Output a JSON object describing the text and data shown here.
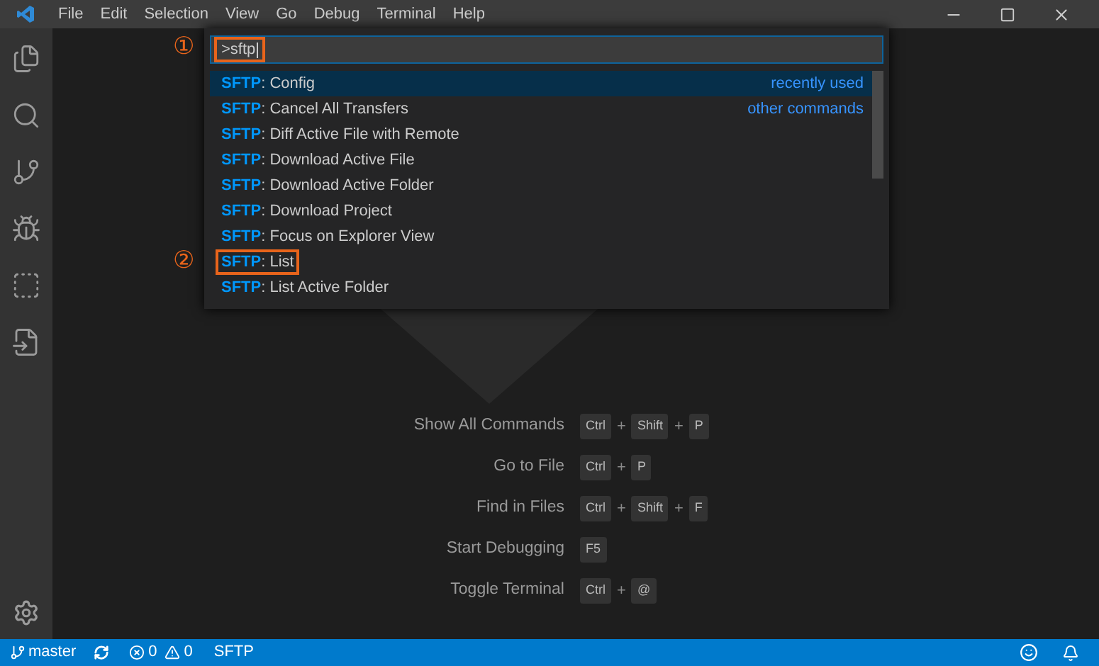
{
  "menu": [
    "File",
    "Edit",
    "Selection",
    "View",
    "Go",
    "Debug",
    "Terminal",
    "Help"
  ],
  "palette": {
    "marker": "①",
    "value": ">sftp",
    "items": [
      {
        "prefix": "SFTP",
        "label": ": Config",
        "hint": "recently used",
        "selected": true,
        "highlighted": false
      },
      {
        "prefix": "SFTP",
        "label": ": Cancel All Transfers",
        "hint": "other commands",
        "selected": false,
        "highlighted": false
      },
      {
        "prefix": "SFTP",
        "label": ": Diff Active File with Remote",
        "selected": false,
        "highlighted": false
      },
      {
        "prefix": "SFTP",
        "label": ": Download Active File",
        "selected": false,
        "highlighted": false
      },
      {
        "prefix": "SFTP",
        "label": ": Download Active Folder",
        "selected": false,
        "highlighted": false
      },
      {
        "prefix": "SFTP",
        "label": ": Download Project",
        "selected": false,
        "highlighted": false
      },
      {
        "prefix": "SFTP",
        "label": ": Focus on Explorer View",
        "selected": false,
        "highlighted": false
      },
      {
        "prefix": "SFTP",
        "label": ": List",
        "selected": false,
        "highlighted": true,
        "marker": "②"
      },
      {
        "prefix": "SFTP",
        "label": ": List Active Folder",
        "selected": false,
        "highlighted": false
      }
    ]
  },
  "shortcuts": {
    "separator": "+",
    "items": [
      {
        "label": "Show All Commands",
        "keys": [
          "Ctrl",
          "Shift",
          "P"
        ]
      },
      {
        "label": "Go to File",
        "keys": [
          "Ctrl",
          "P"
        ]
      },
      {
        "label": "Find in Files",
        "keys": [
          "Ctrl",
          "Shift",
          "F"
        ]
      },
      {
        "label": "Start Debugging",
        "keys": [
          "F5"
        ]
      },
      {
        "label": "Toggle Terminal",
        "keys": [
          "Ctrl",
          "@"
        ]
      }
    ]
  },
  "status_bar": {
    "branch": "master",
    "errors": "0",
    "warnings": "0",
    "extension": "SFTP"
  }
}
